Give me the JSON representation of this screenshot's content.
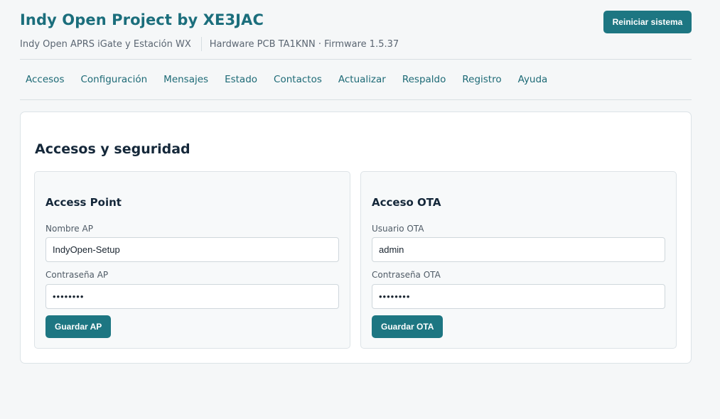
{
  "header": {
    "title": "Indy Open Project by XE3JAC",
    "subtitle": "Indy Open APRS iGate y Estación WX",
    "hardware": "Hardware PCB TA1KNN · Firmware 1.5.37",
    "restart_label": "Reiniciar sistema"
  },
  "nav": {
    "items": [
      {
        "label": "Accesos"
      },
      {
        "label": "Configuración"
      },
      {
        "label": "Mensajes"
      },
      {
        "label": "Estado"
      },
      {
        "label": "Contactos"
      },
      {
        "label": "Actualizar"
      },
      {
        "label": "Respaldo"
      },
      {
        "label": "Registro"
      },
      {
        "label": "Ayuda"
      }
    ]
  },
  "main": {
    "title": "Accesos y seguridad",
    "ap": {
      "title": "Access Point",
      "name_label": "Nombre AP",
      "name_value": "IndyOpen-Setup",
      "password_label": "Contraseña AP",
      "password_value": "••••••••",
      "save_label": "Guardar AP"
    },
    "ota": {
      "title": "Acceso OTA",
      "user_label": "Usuario OTA",
      "user_value": "admin",
      "password_label": "Contraseña OTA",
      "password_value": "••••••••",
      "save_label": "Guardar OTA"
    }
  },
  "colors": {
    "accent": "#1d7682",
    "title": "#1b6e7c",
    "background": "#f5f7f8"
  }
}
